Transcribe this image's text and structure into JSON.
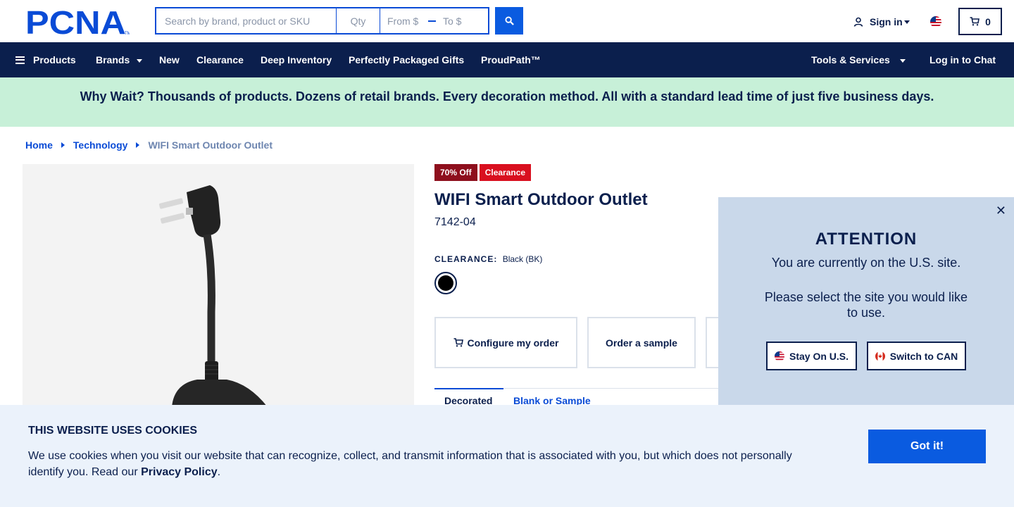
{
  "header": {
    "logo_text": "PCNA",
    "search_placeholder": "Search by brand, product or SKU",
    "qty_placeholder": "Qty",
    "price_from_placeholder": "From $",
    "price_to_placeholder": "To $",
    "signin_label": "Sign in",
    "cart_count": "0"
  },
  "nav": {
    "products": "Products",
    "brands": "Brands",
    "new": "New",
    "clearance": "Clearance",
    "deep_inventory": "Deep Inventory",
    "gifts": "Perfectly Packaged Gifts",
    "proudpath": "ProudPath™",
    "tools": "Tools & Services",
    "chat": "Log in to Chat"
  },
  "banner": {
    "text": "Why Wait? Thousands of products. Dozens of retail brands. Every decoration method. All with a standard lead time of just five business days."
  },
  "breadcrumb": {
    "home": "Home",
    "category": "Technology",
    "current": "WIFI Smart Outdoor Outlet"
  },
  "product": {
    "badge_discount": "70% Off",
    "badge_clearance": "Clearance",
    "title": "WIFI Smart Outdoor Outlet",
    "sku": "7142-04",
    "color_label": "CLEARANCE:",
    "color_value": "Black (BK)",
    "swatch_color": "#000000",
    "configure_label": "Configure my order",
    "sample_label": "Order a sample",
    "tab_active": "Decorated",
    "tab_inactive": "Blank or Sample"
  },
  "attention": {
    "title": "ATTENTION",
    "line1": "You are currently on the U.S. site.",
    "line2": "Please select the site you would like to use.",
    "stay_label": "Stay On U.S.",
    "switch_label": "Switch to CAN"
  },
  "cookie": {
    "title": "THIS WEBSITE USES COOKIES",
    "text": "We use cookies when you visit our website that can recognize, collect, and transmit information that is associated with you, but which does not personally identify you. Read our ",
    "link": "Privacy Policy",
    "end": ".",
    "button": "Got it!"
  },
  "colors": {
    "navy": "#0b1f4d",
    "brand_blue": "#0a4bd6",
    "banner_green": "#c7f0d8",
    "clearance_red": "#d9101f"
  }
}
